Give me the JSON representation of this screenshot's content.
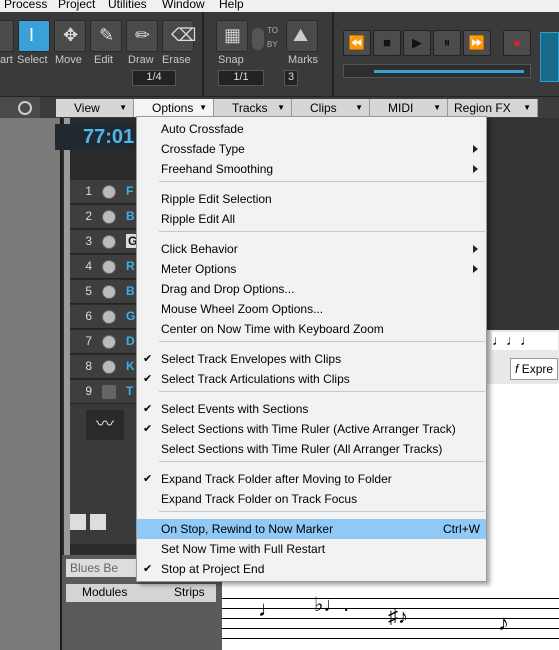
{
  "menubar": {
    "items": [
      "Process",
      "Project",
      "Utilities",
      "Window",
      "Help"
    ]
  },
  "toolbar": {
    "tools": [
      "art",
      "Select",
      "Move",
      "Edit",
      "Draw",
      "Erase"
    ],
    "snap_label": "Snap",
    "snap_value": "1/1",
    "to_label": "TO",
    "by_label": "BY",
    "snap_count": "3",
    "marks_label": "Marks",
    "draw_division": "1/4"
  },
  "viewbar": {
    "menus": [
      "View",
      "Options",
      "Tracks",
      "Clips",
      "MIDI",
      "Region FX"
    ]
  },
  "now_time": "77:01",
  "tracks": [
    {
      "num": "1",
      "name": "F"
    },
    {
      "num": "2",
      "name": "B"
    },
    {
      "num": "3",
      "name": "G"
    },
    {
      "num": "4",
      "name": "R"
    },
    {
      "num": "5",
      "name": "B"
    },
    {
      "num": "6",
      "name": "G"
    },
    {
      "num": "7",
      "name": "D"
    },
    {
      "num": "8",
      "name": "K"
    },
    {
      "num": "9",
      "name": "T"
    }
  ],
  "console": {
    "title": "Blues Be",
    "tabs": [
      "Modules",
      "Strips"
    ]
  },
  "right_pane": {
    "expr_label": "Expre"
  },
  "menu": {
    "items": [
      {
        "label": "Auto Crossfade",
        "checked": false,
        "submenu": false
      },
      {
        "label": "Crossfade Type",
        "checked": false,
        "submenu": true
      },
      {
        "label": "Freehand Smoothing",
        "checked": false,
        "submenu": true
      },
      {
        "label": "Ripple Edit Selection",
        "checked": false,
        "submenu": false
      },
      {
        "label": "Ripple Edit All",
        "checked": false,
        "submenu": false
      },
      {
        "label": "Click Behavior",
        "checked": false,
        "submenu": true
      },
      {
        "label": "Meter Options",
        "checked": false,
        "submenu": true
      },
      {
        "label": "Drag and Drop Options...",
        "checked": false,
        "submenu": false
      },
      {
        "label": "Mouse Wheel Zoom Options...",
        "checked": false,
        "submenu": false
      },
      {
        "label": "Center on Now Time with Keyboard Zoom",
        "checked": false,
        "submenu": false
      },
      {
        "label": "Select Track Envelopes with Clips",
        "checked": true,
        "submenu": false
      },
      {
        "label": "Select Track Articulations with Clips",
        "checked": true,
        "submenu": false
      },
      {
        "label": "Select Events with Sections",
        "checked": true,
        "submenu": false
      },
      {
        "label": "Select Sections with Time Ruler (Active Arranger Track)",
        "checked": true,
        "submenu": false
      },
      {
        "label": "Select Sections with Time Ruler (All Arranger Tracks)",
        "checked": false,
        "submenu": false
      },
      {
        "label": "Expand Track Folder after Moving to Folder",
        "checked": true,
        "submenu": false
      },
      {
        "label": "Expand Track Folder on Track Focus",
        "checked": false,
        "submenu": false
      },
      {
        "label": "On Stop, Rewind to Now Marker",
        "checked": false,
        "submenu": false,
        "shortcut": "Ctrl+W",
        "highlighted": true
      },
      {
        "label": "Set Now Time with Full Restart",
        "checked": false,
        "submenu": false
      },
      {
        "label": "Stop at Project End",
        "checked": true,
        "submenu": false
      }
    ]
  },
  "colors": {
    "accent": "#3aa0d8",
    "highlight": "#90c8f6",
    "time": "#4fb8e8"
  }
}
